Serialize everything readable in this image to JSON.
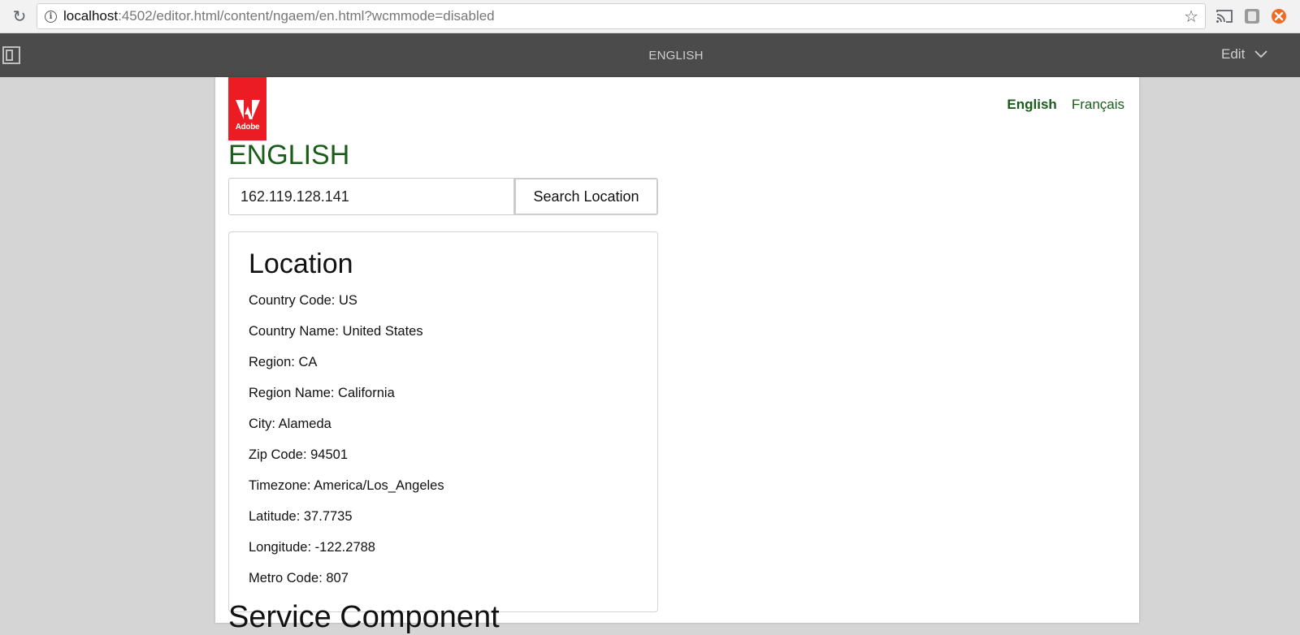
{
  "browser": {
    "url_host": "localhost",
    "url_rest": ":4502/editor.html/content/ngaem/en.html?wcmmode=disabled",
    "icons": [
      "reload-icon",
      "info-icon",
      "star-icon",
      "cast-icon",
      "extension-icon",
      "extension-orange-icon"
    ]
  },
  "editor": {
    "page_title": "ENGLISH",
    "mode_label": "Edit",
    "icons": [
      "sidebar-toggle-icon",
      "chevron-down-icon"
    ]
  },
  "page": {
    "logo_text": "Adobe",
    "language_nav": {
      "english": "English",
      "french": "Français"
    },
    "heading": "ENGLISH",
    "search": {
      "value": "162.119.128.141",
      "button_label": "Search Location"
    },
    "location": {
      "title": "Location",
      "fields": [
        "Country Code: US",
        "Country Name: United States",
        "Region: CA",
        "Region Name: California",
        "City: Alameda",
        "Zip Code: 94501",
        "Timezone: America/Los_Angeles",
        "Latitude: 37.7735",
        "Longitude: -122.2788",
        "Metro Code: 807"
      ]
    },
    "next_heading": "Service Component"
  },
  "colors": {
    "adobe_red": "#ec1c24",
    "link_green": "#1a5c1a",
    "editor_bar": "#4b4b4b"
  }
}
